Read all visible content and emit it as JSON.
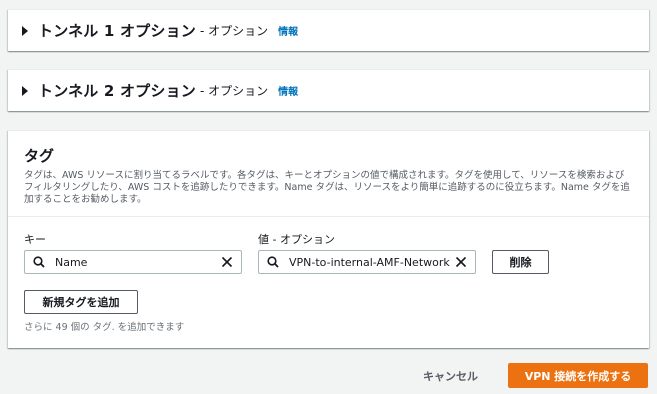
{
  "tunnel1": {
    "title": "トンネル 1 オプション",
    "optional": "- オプション",
    "info": "情報"
  },
  "tunnel2": {
    "title": "トンネル 2 オプション",
    "optional": "- オプション",
    "info": "情報"
  },
  "tags": {
    "title": "タグ",
    "description": "タグは、AWS リソースに割り当てるラベルです。各タグは、キーとオプションの値で構成されます。タグを使用して、リソースを検索およびフィルタリングしたり、AWS コストを追跡したりできます。Name タグは、リソースをより簡単に追跡するのに役立ちます。Name タグを追加することをお勧めします。",
    "key_label": "キー",
    "value_label": "値 - オプション",
    "key_value": "Name",
    "value_value": "VPN-to-internal-AMF-Network",
    "remove_button": "削除",
    "add_button": "新規タグを追加",
    "remaining_text": "さらに 49 個の タグ. を追加できます"
  },
  "footer": {
    "cancel": "キャンセル",
    "create": "VPN 接続を作成する"
  },
  "colors": {
    "accent": "#ec7211",
    "link": "#0073bb",
    "background": "#f2f3f3"
  }
}
